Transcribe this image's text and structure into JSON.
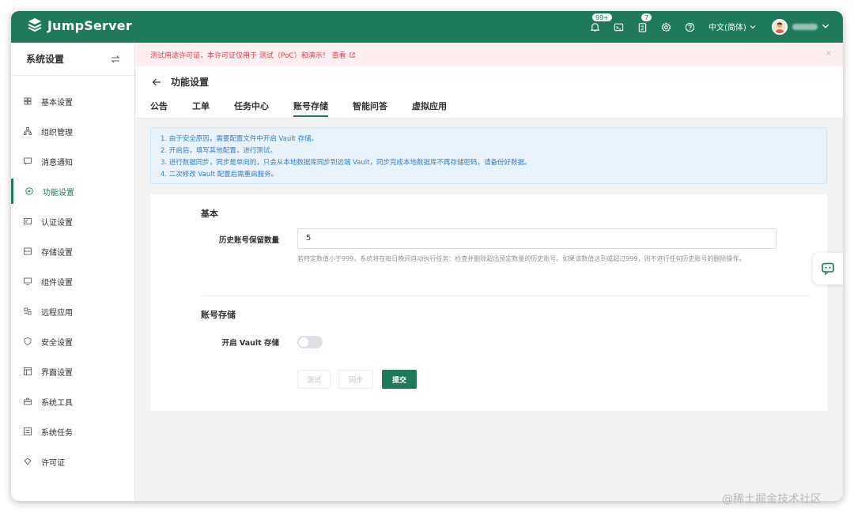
{
  "app": {
    "name": "JumpServer",
    "notifications_badge": "99+",
    "tasks_badge": "7",
    "language": "中文(简体)"
  },
  "sidebar": {
    "title": "系统设置",
    "items": [
      {
        "label": "基本设置",
        "icon": "grid-icon"
      },
      {
        "label": "组织管理",
        "icon": "org-tree-icon"
      },
      {
        "label": "消息通知",
        "icon": "message-icon"
      },
      {
        "label": "功能设置",
        "icon": "feature-icon",
        "active": true
      },
      {
        "label": "认证设置",
        "icon": "id-card-icon"
      },
      {
        "label": "存储设置",
        "icon": "storage-icon"
      },
      {
        "label": "组件设置",
        "icon": "monitor-icon"
      },
      {
        "label": "远程应用",
        "icon": "apps-icon"
      },
      {
        "label": "安全设置",
        "icon": "shield-icon"
      },
      {
        "label": "界面设置",
        "icon": "layout-icon"
      },
      {
        "label": "系统工具",
        "icon": "toolbox-icon"
      },
      {
        "label": "系统任务",
        "icon": "task-list-icon"
      },
      {
        "label": "许可证",
        "icon": "license-icon"
      }
    ]
  },
  "alert": {
    "text": "测试用途许可证，本许可证仅用于 测试（PoC）和演示！ 查看"
  },
  "page": {
    "title": "功能设置",
    "tabs": [
      "公告",
      "工单",
      "任务中心",
      "账号存储",
      "智能问答",
      "虚拟应用"
    ],
    "active_tab": "账号存储"
  },
  "info": [
    "1. 由于安全原因，需要配置文件中开启 Vault 存储。",
    "2. 开启后，填写其他配置，进行测试。",
    "3. 进行数据同步，同步是单向的，只会从本地数据库同步到远端 Vault，同步完成本地数据库不再存储密码，请备份好数据。",
    "4. 二次修改 Vault 配置后需重启服务。"
  ],
  "form": {
    "section_basic": "基本",
    "history_label": "历史账号保留数量",
    "history_value": "5",
    "history_hint": "若特定数值小于999，系统将在每日晚间自动执行任务：检查并删除超出预定数量的历史账号。如果该数值达到或超过999，则不进行任何历史账号的删除操作。",
    "section_storage": "账号存储",
    "vault_label": "开启 Vault 存储",
    "vault_enabled": false,
    "btn_test": "测试",
    "btn_sync": "同步",
    "btn_submit": "提交"
  },
  "watermark": "@稀土掘金技术社区",
  "colors": {
    "brand": "#1f7a5c",
    "alert_text": "#e0444b",
    "alert_bg": "#fdeff0",
    "info_text": "#3a7fc4",
    "info_bg": "#e8f3fc"
  }
}
